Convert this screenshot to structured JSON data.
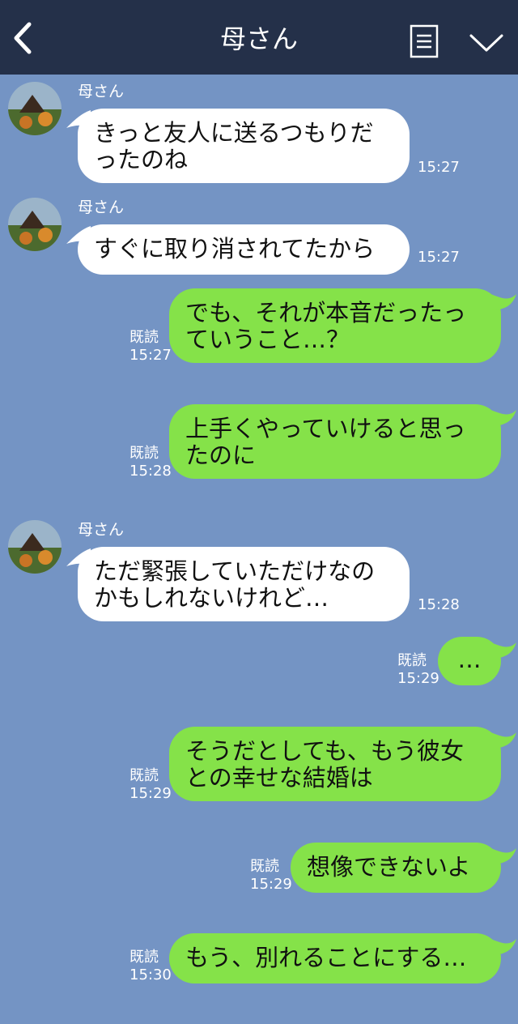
{
  "header": {
    "title": "母さん",
    "back_icon": "chevron-left-icon",
    "menu_icon": "menu-icon",
    "chevron_icon": "chevron-down-icon",
    "background": "#243049"
  },
  "colors": {
    "chat_background": "#7494c4",
    "incoming_bubble": "#ffffff",
    "outgoing_bubble": "#85e249"
  },
  "messages": [
    {
      "sender": "母さん",
      "lines": [
        "きっと友人に送るつもりだ",
        "ったのね"
      ],
      "time": "15:27"
    },
    {
      "sender": "母さん",
      "lines": [
        "すぐに取り消されてたから"
      ],
      "time": "15:27"
    },
    {
      "lines": [
        "でも、それが本音だったっ",
        "ていうこと…？"
      ],
      "read": "既読",
      "time": "15:27"
    },
    {
      "lines": [
        "上手くやっていけると思っ",
        "たのに"
      ],
      "read": "既読",
      "time": "15:28"
    },
    {
      "sender": "母さん",
      "lines": [
        "ただ緊張していただけなの",
        "かもしれないけれど…"
      ],
      "time": "15:28"
    },
    {
      "lines": [
        "…"
      ],
      "read": "既読",
      "time": "15:29"
    },
    {
      "lines": [
        "そうだとしても、もう彼女",
        "との幸せな結婚は"
      ],
      "read": "既読",
      "time": "15:29"
    },
    {
      "lines": [
        "想像できないよ"
      ],
      "read": "既読",
      "time": "15:29"
    },
    {
      "lines": [
        "もう、別れることにする…"
      ],
      "read": "既読",
      "time": "15:30"
    }
  ]
}
